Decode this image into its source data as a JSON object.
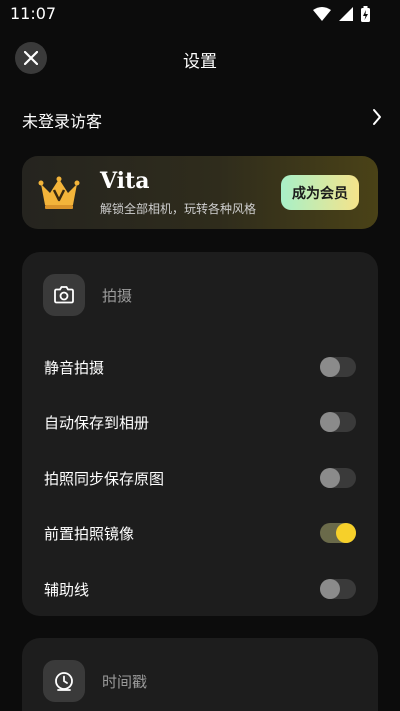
{
  "status_bar": {
    "time": "11:07"
  },
  "header": {
    "title": "设置"
  },
  "guest": {
    "label": "未登录访客"
  },
  "vip": {
    "name": "Vita",
    "subtitle": "解锁全部相机，玩转各种风格",
    "button": "成为会员",
    "accent": "#f5e38a"
  },
  "sections": [
    {
      "title": "拍摄",
      "icon": "camera-icon",
      "items": [
        {
          "label": "静音拍摄",
          "on": false
        },
        {
          "label": "自动保存到相册",
          "on": false
        },
        {
          "label": "拍照同步保存原图",
          "on": false
        },
        {
          "label": "前置拍照镜像",
          "on": true
        },
        {
          "label": "辅助线",
          "on": false
        }
      ]
    },
    {
      "title": "时间戳",
      "icon": "timestamp-icon",
      "items": []
    }
  ]
}
